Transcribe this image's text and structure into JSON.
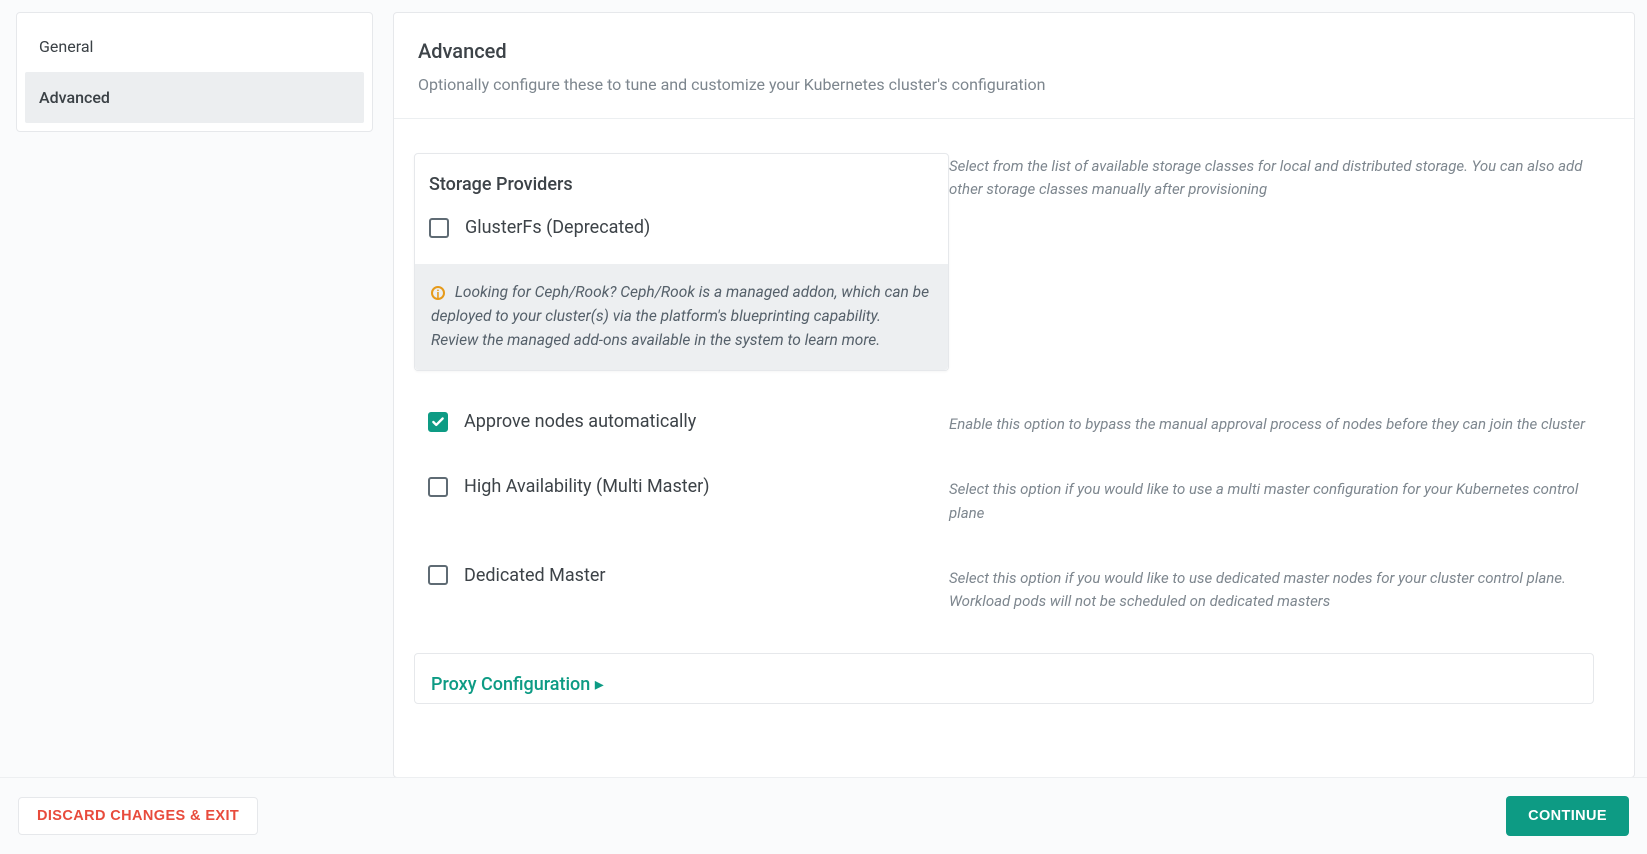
{
  "sidebar": {
    "items": [
      {
        "label": "General"
      },
      {
        "label": "Advanced"
      }
    ]
  },
  "header": {
    "title": "Advanced",
    "subtitle": "Optionally configure these to tune and customize your Kubernetes cluster's configuration"
  },
  "storage": {
    "panel_title": "Storage Providers",
    "option_label": "GlusterFs (Deprecated)",
    "info_text": "Looking for Ceph/Rook? Ceph/Rook is a managed addon, which can be deployed to your cluster(s) via the platform's blueprinting capability. Review the managed add-ons available in the system to learn more.",
    "help": "Select from the list of available storage classes for local and distributed storage. You can also add other storage classes manually after provisioning"
  },
  "options": [
    {
      "label": "Approve nodes automatically",
      "checked": true,
      "help": "Enable this option to bypass the manual approval process of nodes before they can join the cluster"
    },
    {
      "label": "High Availability (Multi Master)",
      "checked": false,
      "help": "Select this option if you would like to use a multi master configuration for your Kubernetes control plane"
    },
    {
      "label": "Dedicated Master",
      "checked": false,
      "help": "Select this option if you would like to use dedicated master nodes for your cluster control plane. Workload pods will not be scheduled on dedicated masters"
    }
  ],
  "expand": {
    "label": "Proxy Configuration ▸"
  },
  "footer": {
    "discard_label": "DISCARD CHANGES & EXIT",
    "continue_label": "CONTINUE"
  },
  "icons": {
    "info_glyph": "i"
  }
}
